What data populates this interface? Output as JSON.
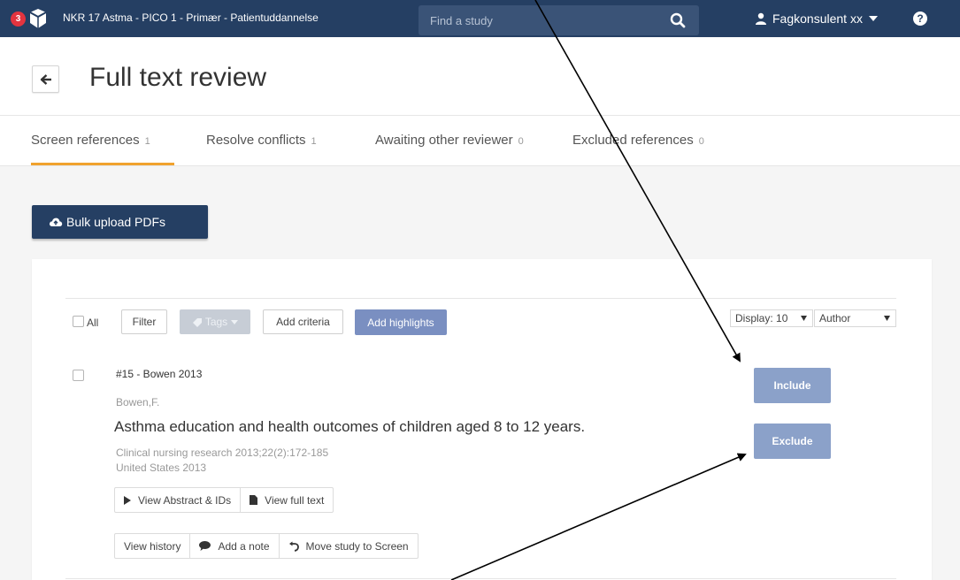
{
  "topbar": {
    "notification_count": "3",
    "project_title": "NKR 17 Astma - PICO 1 - Primær - Patientuddannelse",
    "search_placeholder": "Find a study",
    "user_name": "Fagkonsulent xx",
    "help_symbol": "?",
    "icons": [
      "covidence-logo-icon",
      "search-icon",
      "user-icon",
      "caret-down-icon",
      "help-icon"
    ]
  },
  "header": {
    "title": "Full text review",
    "back_icon": "arrow-left-icon"
  },
  "tabs": [
    {
      "label": "Screen references",
      "count": "1",
      "active": true
    },
    {
      "label": "Resolve conflicts",
      "count": "1",
      "active": false
    },
    {
      "label": "Awaiting other reviewer",
      "count": "0",
      "active": false
    },
    {
      "label": "Excluded references",
      "count": "0",
      "active": false
    }
  ],
  "bulk_upload": {
    "label": "Bulk upload PDFs",
    "icon": "cloud-upload-icon"
  },
  "toolbar": {
    "all_label": "All",
    "filter_label": "Filter",
    "tags_label": "Tags",
    "add_criteria_label": "Add criteria",
    "add_highlights_label": "Add highlights",
    "display_label": "Display: 10",
    "sort_label": "Author"
  },
  "reference": {
    "id_label": "#15 - Bowen 2013",
    "author": "Bowen,F.",
    "title": "Asthma education and health outcomes of children aged 8 to 12 years.",
    "journal": "Clinical nursing research 2013;22(2):172-185",
    "country_year": "United States 2013",
    "view_abstract_label": "View Abstract & IDs",
    "view_full_text_label": "View full text",
    "view_history_label": "View history",
    "add_note_label": "Add a note",
    "move_study_label": "Move study to Screen"
  },
  "decision": {
    "include_label": "Include",
    "exclude_label": "Exclude"
  },
  "colors": {
    "topbar": "#253f63",
    "tab_accent": "#f0a22e",
    "decision_button": "#8ba1c9",
    "highlights_button": "#7a8fc1",
    "badge": "#e3343f"
  }
}
